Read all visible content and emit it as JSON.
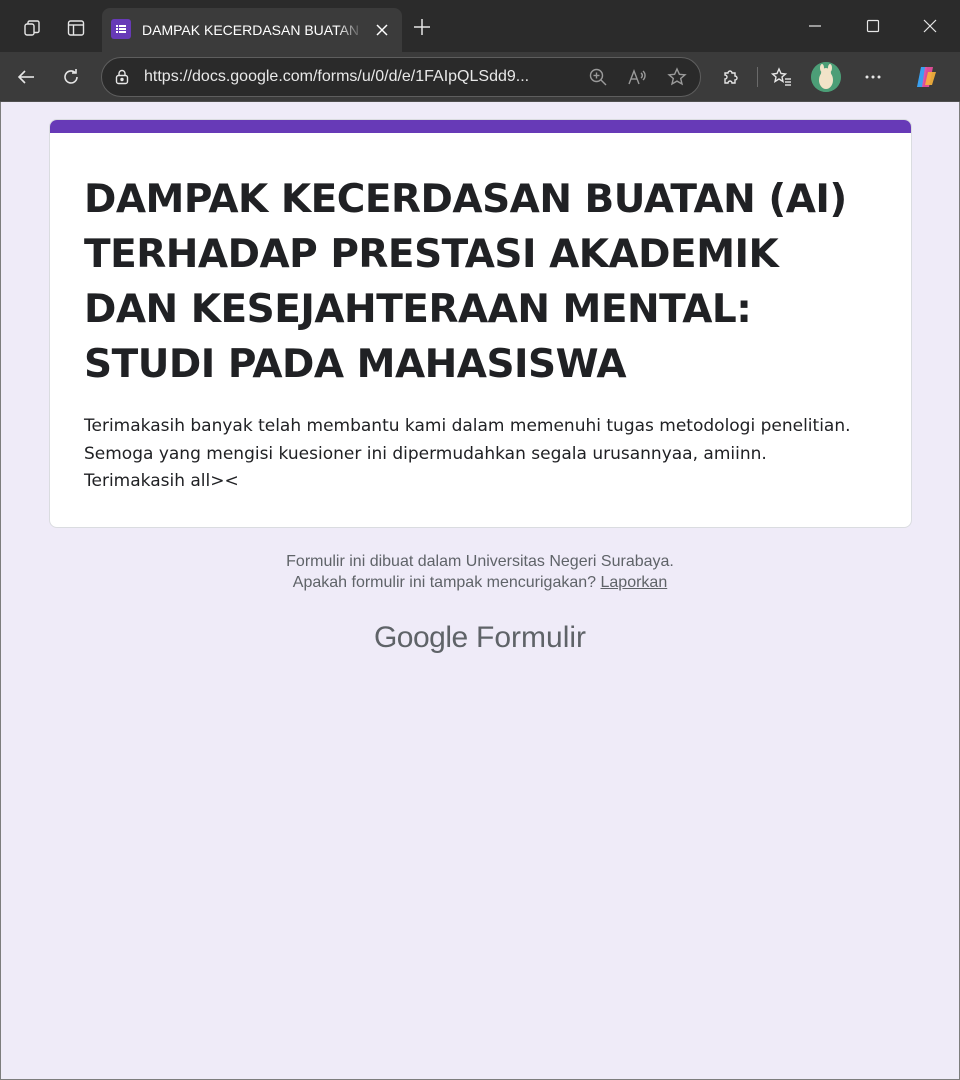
{
  "browser": {
    "tab": {
      "title": "DAMPAK KECERDASAN BUATAN (AI) TERHADAP PRESTASI AKADEMIK DAN KESEJAHTERAAN MENTAL: STUDI PADA MAHASISWA",
      "favicon": "google-forms-icon"
    },
    "address": {
      "url": "https://docs.google.com/forms/u/0/d/e/1FAIpQLSdd9..."
    },
    "icons": {
      "workspaces": "workspaces-icon",
      "tab_actions": "tab-actions-icon",
      "new_tab": "plus-icon",
      "minimize": "minimize-icon",
      "maximize": "maximize-icon",
      "close": "close-icon",
      "back": "back-arrow-icon",
      "refresh": "refresh-icon",
      "lock": "lock-icon",
      "zoom": "zoom-icon",
      "read_aloud": "read-aloud-icon",
      "favorite": "star-icon",
      "extensions": "puzzle-icon",
      "favorites": "favorites-icon",
      "profile": "avatar",
      "menu": "more-icon",
      "copilot": "copilot-icon"
    }
  },
  "form": {
    "accent_color": "#673ab7",
    "title": "DAMPAK KECERDASAN BUATAN (AI) TERHADAP PRESTASI AKADEMIK DAN KESEJAHTERAAN MENTAL: STUDI PADA MAHASISWA",
    "description_lines": [
      "Terimakasih banyak telah membantu kami dalam memenuhi tugas metodologi penelitian.",
      "Semoga yang mengisi kuesioner ini dipermudahkan segala urusannyaa, amiinn.",
      "Terimakasih all><"
    ]
  },
  "footer": {
    "created_in": "Formulir ini dibuat dalam Universitas Negeri Surabaya.",
    "suspicious_prefix": "Apakah formulir ini tampak mencurigakan?",
    "report_link": "Laporkan",
    "brand_google": "Google",
    "brand_product": "Formulir"
  },
  "page_background": "#efebf8"
}
